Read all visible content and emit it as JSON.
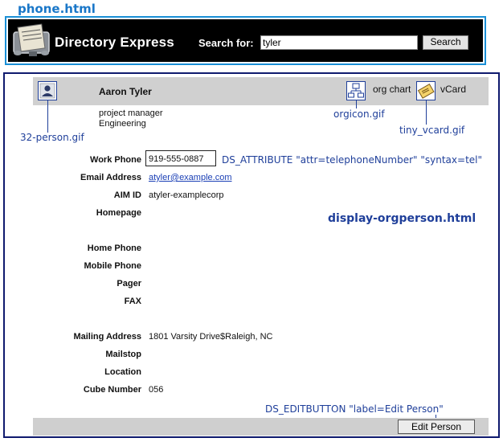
{
  "annotations": {
    "phone_html": "phone.html",
    "person_gif": "32-person.gif",
    "orgicon_gif": "orgicon.gif",
    "tiny_vcard_gif": "tiny_vcard.gif",
    "ds_attribute": "DS_ATTRIBUTE \"attr=telephoneNumber\" \"syntax=tel\"",
    "display_orgperson": "display-orgperson.html",
    "ds_editbutton": "DS_EDITBUTTON \"label=Edit Person\""
  },
  "header": {
    "app_title": "Directory Express",
    "search_label": "Search for:",
    "search_value": "tyler",
    "search_button": "Search"
  },
  "person": {
    "name": "Aaron Tyler",
    "title": "project manager",
    "department": "Engineering",
    "org_chart_label": "org chart",
    "vcard_label": "vCard"
  },
  "fields": {
    "work_phone": {
      "label": "Work Phone",
      "value": "919-555-0887"
    },
    "email": {
      "label": "Email Address",
      "value": "atyler@example.com"
    },
    "aim": {
      "label": "AIM ID",
      "value": "atyler-examplecorp"
    },
    "homepage": {
      "label": "Homepage",
      "value": ""
    },
    "home_phone": {
      "label": "Home Phone",
      "value": ""
    },
    "mobile_phone": {
      "label": "Mobile Phone",
      "value": ""
    },
    "pager": {
      "label": "Pager",
      "value": ""
    },
    "fax": {
      "label": "FAX",
      "value": ""
    },
    "mailing_address": {
      "label": "Mailing Address",
      "value": "1801 Varsity Drive$Raleigh, NC"
    },
    "mailstop": {
      "label": "Mailstop",
      "value": ""
    },
    "location": {
      "label": "Location",
      "value": ""
    },
    "cube_number": {
      "label": "Cube Number",
      "value": "056"
    }
  },
  "actions": {
    "edit_person": "Edit Person"
  },
  "colors": {
    "annotation_blue": "#1f3f9a",
    "phone_title_blue": "#1a77c8",
    "header_frame": "#1a8fd6",
    "content_frame": "#0f1a6e",
    "header_bg": "#000000",
    "name_bar_bg": "#d0d0d0",
    "link_blue": "#1a3fb5"
  },
  "icons": {
    "rolodex": "rolodex-icon",
    "person": "person-icon",
    "org": "org-chart-icon",
    "vcard": "vcard-icon"
  }
}
